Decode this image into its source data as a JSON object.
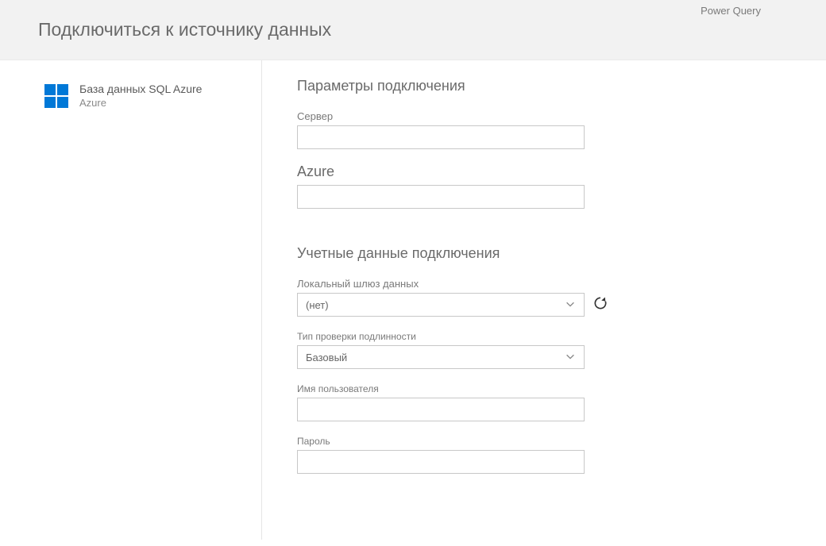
{
  "brand": "Power Query",
  "page_title": "Подключиться к источнику данных",
  "sidebar": {
    "source_title": "База данных SQL Azure",
    "source_sub": "Azure"
  },
  "sections": {
    "connection_params": "Параметры подключения",
    "connection_creds": "Учетные данные подключения"
  },
  "fields": {
    "server_label": "Сервер",
    "server_value": "",
    "azure_label": "Azure",
    "azure_value": "",
    "gateway_label": "Локальный шлюз данных",
    "gateway_value": "(нет)",
    "auth_type_label": "Тип проверки подлинности",
    "auth_type_value": "Базовый",
    "username_label": "Имя пользователя",
    "username_value": "",
    "password_label": "Пароль",
    "password_value": ""
  }
}
